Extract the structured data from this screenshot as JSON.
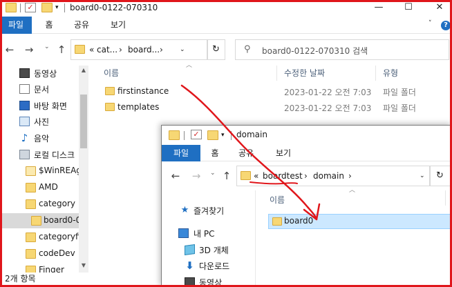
{
  "back_window": {
    "title": "board0-0122-070310",
    "ribbon_tabs": [
      "파일",
      "홈",
      "공유",
      "보기"
    ],
    "help": "?",
    "address": {
      "overflow": "«",
      "crumbs": [
        "cat...",
        "board..."
      ],
      "separator": "›"
    },
    "search_placeholder": "board0-0122-070310 검색",
    "sidebar": [
      {
        "label": "동영상",
        "icon": "video-icon"
      },
      {
        "label": "문서",
        "icon": "document-icon"
      },
      {
        "label": "바탕 화면",
        "icon": "desktop-icon"
      },
      {
        "label": "사진",
        "icon": "pictures-icon"
      },
      {
        "label": "음악",
        "icon": "music-icon"
      },
      {
        "label": "로컬 디스크",
        "icon": "disk-icon"
      },
      {
        "label": "$WinREAg",
        "icon": "folder-icon"
      },
      {
        "label": "AMD",
        "icon": "folder-icon"
      },
      {
        "label": "category",
        "icon": "folder-icon"
      },
      {
        "label": "board0-0",
        "icon": "folder-icon",
        "selected": true
      },
      {
        "label": "categoryfir",
        "icon": "folder-icon"
      },
      {
        "label": "codeDev",
        "icon": "folder-icon"
      },
      {
        "label": "Finger",
        "icon": "folder-icon"
      }
    ],
    "columns": {
      "name": "이름",
      "modified": "수정한 날짜",
      "type": "유형"
    },
    "files": [
      {
        "name": "firstinstance",
        "modified": "2023-01-22 오전 7:03",
        "type": "파일 폴더"
      },
      {
        "name": "templates",
        "modified": "2023-01-22 오전 7:03",
        "type": "파일 폴더"
      }
    ],
    "status": "2개 항목"
  },
  "front_window": {
    "title": "domain",
    "ribbon_tabs": [
      "파일",
      "홈",
      "공유",
      "보기"
    ],
    "address": {
      "overflow": "«",
      "crumbs": [
        "boardtest",
        "domain"
      ],
      "separator": "›"
    },
    "sidebar": [
      {
        "label": "즐겨찾기",
        "icon": "quick-access-star-icon"
      },
      {
        "label": "내 PC",
        "icon": "this-pc-icon"
      },
      {
        "label": "3D 개체",
        "icon": "3d-objects-icon"
      },
      {
        "label": "다운로드",
        "icon": "downloads-icon"
      },
      {
        "label": "동영상",
        "icon": "video-icon"
      }
    ],
    "columns": {
      "name": "이름"
    },
    "files": [
      {
        "name": "board0",
        "selected": true
      }
    ]
  },
  "colors": {
    "accent": "#1f6fc2",
    "annotation": "#e0161b",
    "selection": "#cce8ff",
    "folder": "#f7d774"
  }
}
